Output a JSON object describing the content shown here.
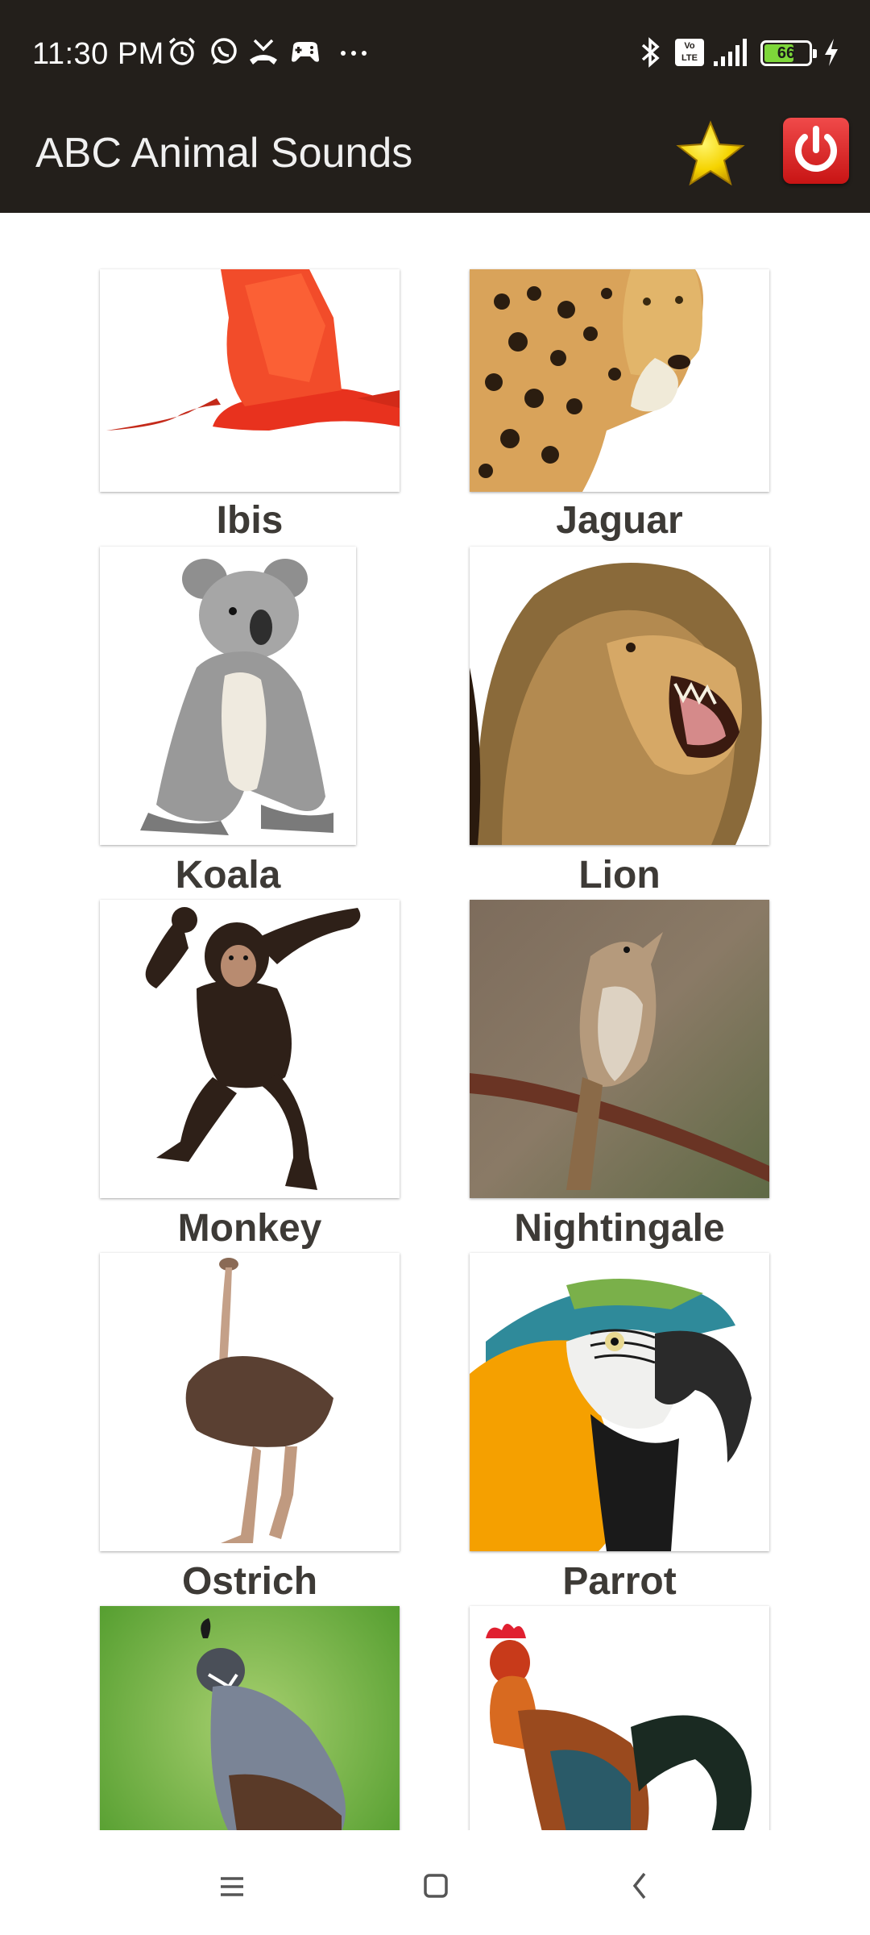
{
  "status_bar": {
    "time": "11:30 PM",
    "battery": "66",
    "icons": [
      "alarm-icon",
      "whatsapp-icon",
      "missed-call-icon",
      "game-icon",
      "more-icon",
      "bluetooth-icon",
      "volte-icon",
      "signal-icon",
      "battery-icon",
      "charging-icon"
    ],
    "volte_text": "Vo LTE"
  },
  "app_bar": {
    "title": "ABC Animal Sounds",
    "favorites_icon": "star-icon",
    "exit_icon": "power-icon"
  },
  "animals": [
    {
      "name": "Ibis"
    },
    {
      "name": "Jaguar"
    },
    {
      "name": "Koala"
    },
    {
      "name": "Lion"
    },
    {
      "name": "Monkey"
    },
    {
      "name": "Nightingale"
    },
    {
      "name": "Ostrich"
    },
    {
      "name": "Parrot"
    },
    {
      "name": ""
    },
    {
      "name": ""
    }
  ],
  "colors": {
    "bar_background": "#231f1b",
    "label_text": "#3d3a36",
    "star": "#f5d300",
    "power_button": "#d81c1c",
    "battery_fill": "#7dd63a"
  },
  "nav_bar": {
    "icons": [
      "menu-icon",
      "home-icon",
      "back-icon"
    ]
  }
}
